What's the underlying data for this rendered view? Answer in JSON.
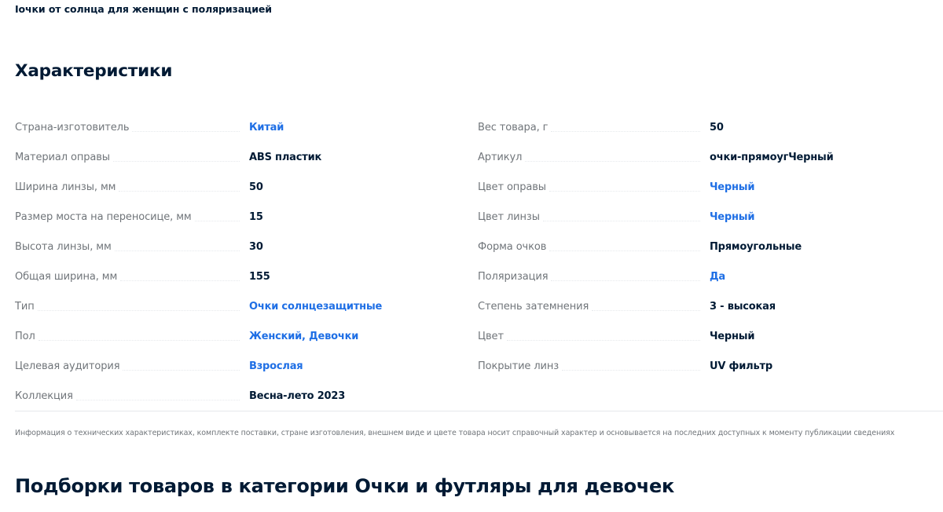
{
  "product": {
    "title": "Iочки от солнца для женщин с поляризацией"
  },
  "characteristics": {
    "title": "Характеристики",
    "left": [
      {
        "key": "Страна-изготовитель",
        "value": "Китай",
        "link": true
      },
      {
        "key": "Материал оправы",
        "value": "ABS пластик",
        "link": false
      },
      {
        "key": "Ширина линзы, мм",
        "value": "50",
        "link": false
      },
      {
        "key": "Размер моста на переносице, мм",
        "value": "15",
        "link": false
      },
      {
        "key": "Высота линзы, мм",
        "value": "30",
        "link": false
      },
      {
        "key": "Общая ширина, мм",
        "value": "155",
        "link": false
      },
      {
        "key": "Тип",
        "value": "Очки солнцезащитные",
        "link": true
      },
      {
        "key": "Пол",
        "value": "Женский, Девочки",
        "link": true
      },
      {
        "key": "Целевая аудитория",
        "value": "Взрослая",
        "link": true
      },
      {
        "key": "Коллекция",
        "value": "Весна-лето 2023",
        "link": false
      }
    ],
    "right": [
      {
        "key": "Вес товара, г",
        "value": "50",
        "link": false
      },
      {
        "key": "Артикул",
        "value": "очки-прямоугЧерный",
        "link": false
      },
      {
        "key": "Цвет оправы",
        "value": "Черный",
        "link": true
      },
      {
        "key": "Цвет линзы",
        "value": "Черный",
        "link": true
      },
      {
        "key": "Форма очков",
        "value": "Прямоугольные",
        "link": false
      },
      {
        "key": "Поляризация",
        "value": "Да",
        "link": true
      },
      {
        "key": "Степень затемнения",
        "value": "3 - высокая",
        "link": false
      },
      {
        "key": "Цвет",
        "value": "Черный",
        "link": false
      },
      {
        "key": "Покрытие линз",
        "value": "UV фильтр",
        "link": false
      }
    ],
    "disclaimer": "Информация о технических характеристиках, комплекте поставки, стране изготовления, внешнем виде и цвете товара носит справочный характер и основывается на последних доступных к моменту публикации сведениях"
  },
  "collections": {
    "title": "Подборки товаров в категории Очки и футляры для девочек"
  },
  "colors": {
    "text": "#001a34",
    "muted": "#70757a",
    "link": "#1f6fe5"
  }
}
